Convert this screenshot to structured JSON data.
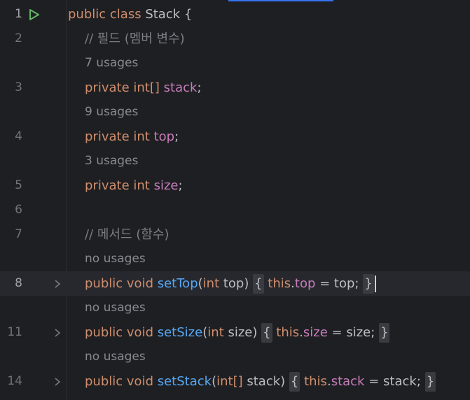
{
  "editor": {
    "accent_color": "#3574f0",
    "lines": [
      {
        "num": "1",
        "text_parts": [
          "public",
          "class",
          "Stack",
          "{"
        ]
      },
      {
        "num": "2",
        "comment": "// 필드 (멤버 변수)"
      },
      {
        "usage": "7 usages"
      },
      {
        "num": "3",
        "kw1": "private",
        "type": "int[]",
        "field": "stack",
        "semi": ";"
      },
      {
        "usage": "9 usages"
      },
      {
        "num": "4",
        "kw1": "private",
        "type": "int",
        "field": "top",
        "semi": ";"
      },
      {
        "usage": "3 usages"
      },
      {
        "num": "5",
        "kw1": "private",
        "type": "int",
        "field": "size",
        "semi": ";"
      },
      {
        "num": "6"
      },
      {
        "num": "7",
        "comment": "// 메서드 (함수)"
      },
      {
        "usage": "no usages"
      },
      {
        "num": "8",
        "kw1": "public",
        "kw2": "void",
        "method": "setTop",
        "param_type": "int",
        "param": "top",
        "this": "this",
        "field": "top",
        "rhs": "top"
      },
      {
        "usage": "no usages"
      },
      {
        "num": "11",
        "kw1": "public",
        "kw2": "void",
        "method": "setSize",
        "param_type": "int",
        "param": "size",
        "this": "this",
        "field": "size",
        "rhs": "size"
      },
      {
        "usage": "no usages"
      },
      {
        "num": "14",
        "kw1": "public",
        "kw2": "void",
        "method": "setStack",
        "param_type": "int[]",
        "param": "stack",
        "this": "this",
        "field": "stack",
        "rhs": "stack"
      }
    ]
  }
}
